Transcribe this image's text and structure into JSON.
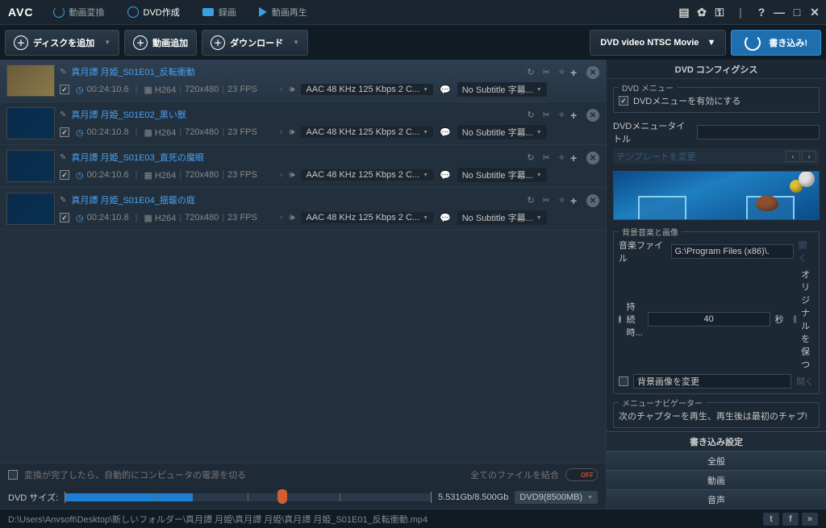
{
  "app": {
    "logo": "AVC"
  },
  "topnav": [
    {
      "label": "動画変換",
      "active": false
    },
    {
      "label": "DVD作成",
      "active": true
    },
    {
      "label": "録画",
      "active": false
    },
    {
      "label": "動画再生",
      "active": false
    }
  ],
  "toolbar": {
    "add_disc": "ディスクを追加",
    "add_video": "動画追加",
    "download": "ダウンロード",
    "profile": "DVD video NTSC Movie",
    "burn": "書き込み!"
  },
  "items": [
    {
      "title": "真月譚 月姫_S01E01_反転衝動",
      "dur": "00:24:10.6",
      "vcodec": "H264",
      "res": "720x480",
      "fps": "23 FPS",
      "audio": "AAC 48 KHz 125 Kbps 2 C...",
      "sub": "No Subtitle 字幕...",
      "sel": true
    },
    {
      "title": "真月譚 月姫_S01E02_黒い獣",
      "dur": "00:24:10.8",
      "vcodec": "H264",
      "res": "720x480",
      "fps": "23 FPS",
      "audio": "AAC 48 KHz 125 Kbps 2 C...",
      "sub": "No Subtitle 字幕...",
      "sel": false
    },
    {
      "title": "真月譚 月姫_S01E03_直死の魔眼",
      "dur": "00:24:10.6",
      "vcodec": "H264",
      "res": "720x480",
      "fps": "23 FPS",
      "audio": "AAC 48 KHz 125 Kbps 2 C...",
      "sub": "No Subtitle 字幕...",
      "sel": false
    },
    {
      "title": "真月譚 月姫_S01E04_揺籠の庭",
      "dur": "00:24:10.8",
      "vcodec": "H264",
      "res": "720x480",
      "fps": "23 FPS",
      "audio": "AAC 48 KHz 125 Kbps 2 C...",
      "sub": "No Subtitle 字幕...",
      "sel": false
    }
  ],
  "bottom": {
    "shutdown": "変換が完了したら、自動的にコンピュータの電源を切る",
    "merge": "全てのファイルを結合",
    "toggle": "OFF",
    "size_label": "DVD サイズ:",
    "size_text": "5.531Gb/8.500Gb",
    "disc_sel": "DVD9(8500MB)"
  },
  "right": {
    "title": "DVD コンフィグシス",
    "menu_group": "DVD メニュー",
    "enable_menu": "DVDメニューを有効にする",
    "menu_title_label": "DVDメニュータイトル",
    "menu_title_value": "",
    "tpl_change": "テンプレートを変更",
    "bg_group": "背景音楽と画像",
    "music_label": "音楽ファイル",
    "music_path": "G:\\Program Files (x86)\\.",
    "open": "開く",
    "duration_label": "持続時...",
    "duration_value": "40",
    "seconds": "秒",
    "keep_original": "オリジナルを保つ",
    "bg_image": "背景画像を変更",
    "nav_group": "メニューナビゲーター",
    "nav_text": "次のチャプターを再生、再生後は最初のチャプ!",
    "burn_settings_hdr": "書き込み設定",
    "tabs": [
      "全般",
      "動画",
      "音声"
    ]
  },
  "status": {
    "path": "D:\\Users\\Anvsoft\\Desktop\\新しいフォルダー\\真月譚 月姫\\真月譚 月姫\\真月譚 月姫_S01E01_反転衝動.mp4",
    "more": "»"
  }
}
